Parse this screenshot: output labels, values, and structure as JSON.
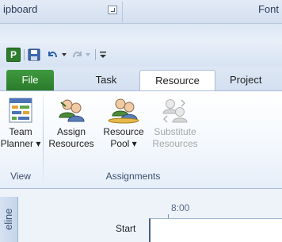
{
  "background_window": {
    "clipboard_group": "ipboard",
    "font_group": "Font"
  },
  "quick_access": {
    "app_icon": "P"
  },
  "tabs": [
    {
      "label": "File"
    },
    {
      "label": "Task"
    },
    {
      "label": "Resource",
      "selected": true
    },
    {
      "label": "Project"
    }
  ],
  "groups": {
    "view": {
      "label": "View",
      "buttons": [
        {
          "label_line1": "Team",
          "label_line2": "Planner ▾",
          "icon": "team-planner-icon"
        }
      ]
    },
    "assignments": {
      "label": "Assignments",
      "buttons": [
        {
          "label_line1": "Assign",
          "label_line2": "Resources",
          "icon": "assign-resources-icon"
        },
        {
          "label_line1": "Resource",
          "label_line2": "Pool ▾",
          "icon": "resource-pool-icon"
        },
        {
          "label_line1": "Substitute",
          "label_line2": "Resources",
          "icon": "substitute-resources-icon",
          "disabled": true
        }
      ]
    }
  },
  "timeline": {
    "side_tab": "eline",
    "time": "8:00",
    "start": "Start"
  },
  "colors": {
    "file_tab": "#2f8a2f",
    "ribbon_border": "#a9bcd6",
    "disabled_text": "#a6a6a6"
  }
}
